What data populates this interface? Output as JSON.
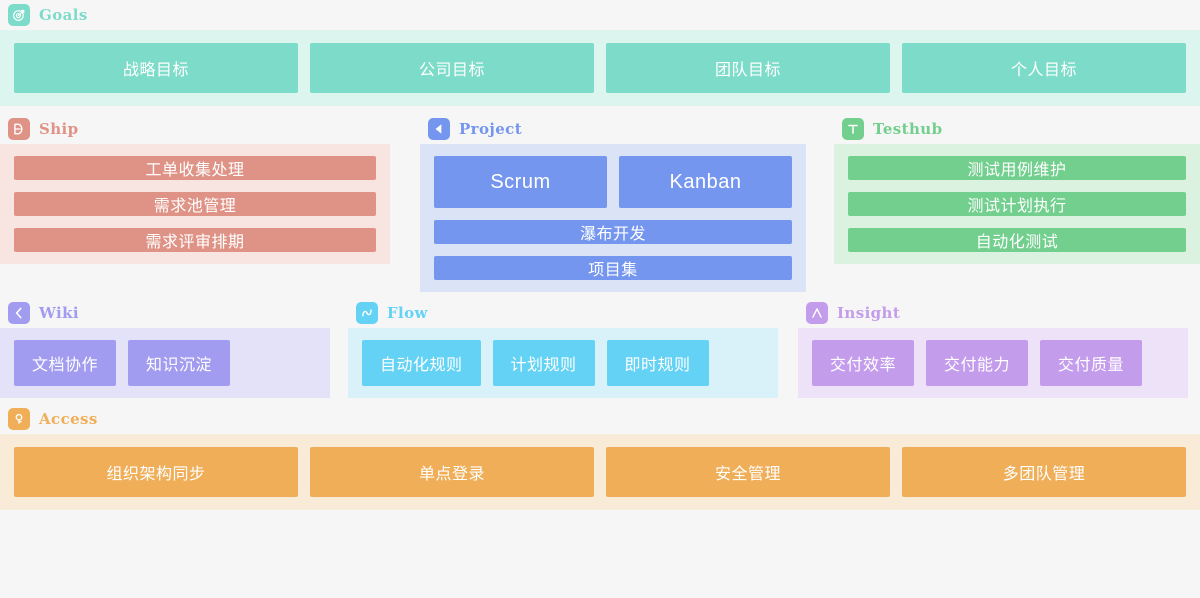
{
  "sections": [
    {
      "key": "goals",
      "title": "Goals",
      "icon": "target-icon",
      "icon_bg": "#7ddcc9",
      "title_color": "#7ddcc9",
      "band_bg": "#ddf5ef",
      "tile_bg": "#7ddcc9",
      "items": [
        "战略目标",
        "公司目标",
        "团队目标",
        "个人目标"
      ]
    },
    {
      "key": "ship",
      "title": "Ship",
      "icon": "ship-arrow-icon",
      "icon_bg": "#df9386",
      "title_color": "#df9386",
      "band_bg": "#f8e5e2",
      "tile_bg": "#df9386",
      "items": [
        "工单收集处理",
        "需求池管理",
        "需求评审排期"
      ]
    },
    {
      "key": "project",
      "title": "Project",
      "icon": "triangle-left-icon",
      "icon_bg": "#7596ef",
      "title_color": "#7596ef",
      "band_bg": "#dbe3f7",
      "tile_bg": "#7596ef",
      "items_pair": [
        "Scrum",
        "Kanban"
      ],
      "items": [
        "瀑布开发",
        "项目集"
      ]
    },
    {
      "key": "testhub",
      "title": "Testhub",
      "icon": "letter-t-icon",
      "icon_bg": "#72cf8e",
      "title_color": "#72cf8e",
      "band_bg": "#dcf2e1",
      "tile_bg": "#72cf8e",
      "items": [
        "测试用例维护",
        "测试计划执行",
        "自动化测试"
      ]
    },
    {
      "key": "wiki",
      "title": "Wiki",
      "icon": "chevron-left-icon",
      "icon_bg": "#a29cf0",
      "title_color": "#a29cf0",
      "band_bg": "#e3e2f8",
      "tile_bg": "#a29cf0",
      "items": [
        "文档协作",
        "知识沉淀"
      ]
    },
    {
      "key": "flow",
      "title": "Flow",
      "icon": "wave-icon",
      "icon_bg": "#63d2f5",
      "title_color": "#63d2f5",
      "band_bg": "#d9f2fa",
      "tile_bg": "#63d2f5",
      "items": [
        "自动化规则",
        "计划规则",
        "即时规则"
      ]
    },
    {
      "key": "insight",
      "title": "Insight",
      "icon": "lambda-icon",
      "icon_bg": "#c49cec",
      "title_color": "#c49cec",
      "band_bg": "#eee2f8",
      "tile_bg": "#c49cec",
      "items": [
        "交付效率",
        "交付能力",
        "交付质量"
      ]
    },
    {
      "key": "access",
      "title": "Access",
      "icon": "key-icon",
      "icon_bg": "#efae57",
      "title_color": "#efae57",
      "band_bg": "#f8ecd8",
      "tile_bg": "#efae57",
      "items": [
        "组织架构同步",
        "单点登录",
        "安全管理",
        "多团队管理"
      ]
    }
  ],
  "goals": {
    "title": "Goals",
    "items": [
      "战略目标",
      "公司目标",
      "团队目标",
      "个人目标"
    ]
  },
  "ship": {
    "title": "Ship",
    "items": [
      "工单收集处理",
      "需求池管理",
      "需求评审排期"
    ]
  },
  "project": {
    "title": "Project",
    "pair": [
      "Scrum",
      "Kanban"
    ],
    "items": [
      "瀑布开发",
      "项目集"
    ]
  },
  "testhub": {
    "title": "Testhub",
    "items": [
      "测试用例维护",
      "测试计划执行",
      "自动化测试"
    ]
  },
  "wiki": {
    "title": "Wiki",
    "items": [
      "文档协作",
      "知识沉淀"
    ]
  },
  "flow": {
    "title": "Flow",
    "items": [
      "自动化规则",
      "计划规则",
      "即时规则"
    ]
  },
  "insight": {
    "title": "Insight",
    "items": [
      "交付效率",
      "交付能力",
      "交付质量"
    ]
  },
  "access": {
    "title": "Access",
    "items": [
      "组织架构同步",
      "单点登录",
      "安全管理",
      "多团队管理"
    ]
  },
  "colors": {
    "page_bg": "#f6f6f6",
    "goals": "#7ddcc9",
    "ship": "#df9386",
    "project": "#7596ef",
    "testhub": "#72cf8e",
    "wiki": "#a29cf0",
    "flow": "#63d2f5",
    "insight": "#c49cec",
    "access": "#efae57"
  }
}
